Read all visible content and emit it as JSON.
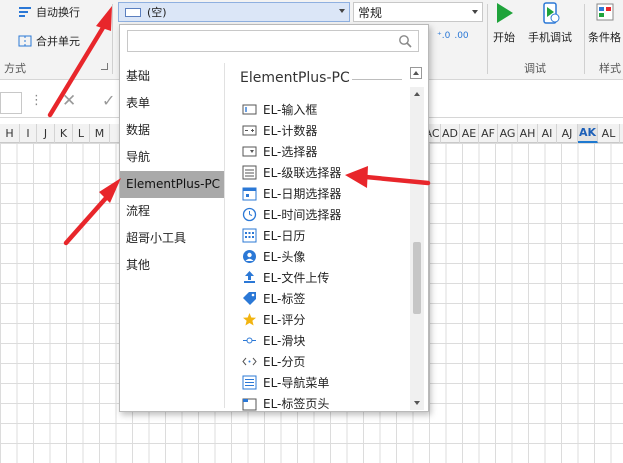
{
  "ribbon": {
    "autowrap_label": "自动换行",
    "merge_label": "合并单元",
    "align_group_label": "方式",
    "style_value": "(空)",
    "format_value": "常规",
    "start_label": "开始",
    "mobile_debug_label": "手机调试",
    "debug_group_label": "调试",
    "cond_format_label": "条件格",
    "style_group_label": "样式"
  },
  "grid": {
    "columns_left": [
      "H",
      "I",
      "J",
      "K",
      "L",
      "M"
    ],
    "columns_right": [
      "AC",
      "AD",
      "AE",
      "AF",
      "AG",
      "AH",
      "AI",
      "AJ",
      "AK",
      "AL"
    ],
    "active_column": "AK"
  },
  "popup": {
    "search_placeholder": "",
    "categories": [
      "基础",
      "表单",
      "数据",
      "导航",
      "ElementPlus-PC",
      "流程",
      "超哥小工具",
      "其他"
    ],
    "selected_category": "ElementPlus-PC",
    "panel_title": "ElementPlus-PC",
    "items": [
      {
        "label": "EL-输入框",
        "icon": "input-icon"
      },
      {
        "label": "EL-计数器",
        "icon": "counter-icon"
      },
      {
        "label": "EL-选择器",
        "icon": "select-icon"
      },
      {
        "label": "EL-级联选择器",
        "icon": "cascader-icon"
      },
      {
        "label": "EL-日期选择器",
        "icon": "date-picker-icon"
      },
      {
        "label": "EL-时间选择器",
        "icon": "clock-icon"
      },
      {
        "label": "EL-日历",
        "icon": "calendar-icon"
      },
      {
        "label": "EL-头像",
        "icon": "avatar-icon"
      },
      {
        "label": "EL-文件上传",
        "icon": "upload-icon"
      },
      {
        "label": "EL-标签",
        "icon": "tag-icon"
      },
      {
        "label": "EL-评分",
        "icon": "star-icon"
      },
      {
        "label": "EL-滑块",
        "icon": "slider-icon"
      },
      {
        "label": "EL-分页",
        "icon": "pagination-icon"
      },
      {
        "label": "EL-导航菜单",
        "icon": "menu-icon"
      },
      {
        "label": "EL-标签页头",
        "icon": "tabs-icon"
      }
    ]
  },
  "colors": {
    "accent_blue": "#2b78d6",
    "start_green": "#1fa33b",
    "arrow_red": "#e8262b",
    "selected_category_bg": "#a9a9a9"
  }
}
